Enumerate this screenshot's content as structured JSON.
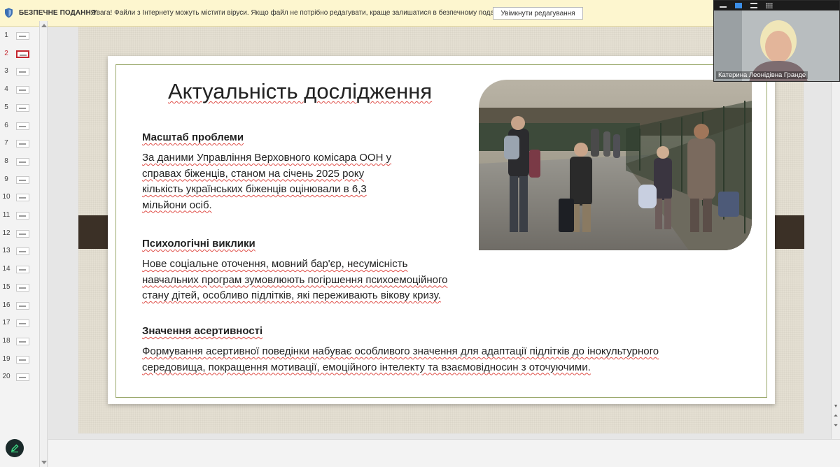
{
  "protected_view": {
    "title": "БЕЗПЕЧНЕ ПОДАННЯ",
    "message": "Увага! Файли з Інтернету можуть містити віруси. Якщо файл не потрібно редагувати, краще залишатися в безпечному поданні.",
    "enable_button": "Увімкнути редагування",
    "icon": "shield-icon"
  },
  "thumbnails": {
    "active_index": 2,
    "numbers": [
      "1",
      "2",
      "3",
      "4",
      "5",
      "6",
      "7",
      "8",
      "9",
      "10",
      "11",
      "12",
      "13",
      "14",
      "15",
      "16",
      "17",
      "18",
      "19",
      "20"
    ]
  },
  "slide": {
    "title": "Актуальність дослідження",
    "sections": [
      {
        "heading": "Масштаб проблеми",
        "lines": [
          "За даними Управління Верховного комісара ООН у",
          "справах біженців, станом на січень 2025 року",
          "кількість українських біженців оцінювали в 6,3",
          "мільйони осіб."
        ]
      },
      {
        "heading": "Психологічні виклики",
        "lines": [
          "Нове соціальне оточення, мовний бар'єр, несумісність",
          "навчальних програм зумовлюють погіршення психоемоційного",
          "стану дітей, особливо підлітків, які переживають вікову кризу."
        ]
      },
      {
        "heading": "Значення асертивності",
        "lines": [
          "Формування асертивної поведінки набуває особливого значення для адаптації підлітків до інокультурного",
          "середовища, покращення мотивації, емоційного інтелекту та взаємовідносин з оточуючими."
        ]
      }
    ]
  },
  "video": {
    "participant_name": "Катерина Леонідівна Гранде"
  },
  "colors": {
    "accent_active": "#c4262e",
    "protected_bar": "#fdf6cf",
    "slide_frame": "#9aa86b",
    "tab_brown": "#3b3026"
  }
}
